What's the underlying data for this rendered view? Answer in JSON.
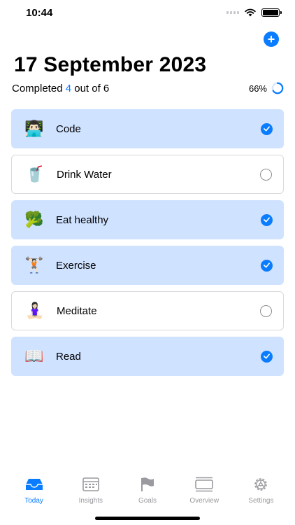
{
  "status_bar": {
    "time": "10:44"
  },
  "header": {
    "title": "17 September 2023",
    "progress_prefix": "Completed",
    "progress_done": "4",
    "progress_suffix": "out of 6",
    "percent": "66%",
    "percent_value": 0.66
  },
  "habits": [
    {
      "emoji": "👨🏻‍💻",
      "label": "Code",
      "done": true
    },
    {
      "emoji": "🥤",
      "label": "Drink Water",
      "done": false
    },
    {
      "emoji": "🥦",
      "label": "Eat healthy",
      "done": true
    },
    {
      "emoji": "🏋🏻",
      "label": "Exercise",
      "done": true
    },
    {
      "emoji": "🧘🏻‍♀️",
      "label": "Meditate",
      "done": false
    },
    {
      "emoji": "📖",
      "label": "Read",
      "done": true
    }
  ],
  "tabs": [
    {
      "label": "Today",
      "icon": "tray-icon",
      "active": true
    },
    {
      "label": "Insights",
      "icon": "calendar-icon",
      "active": false
    },
    {
      "label": "Goals",
      "icon": "flag-icon",
      "active": false
    },
    {
      "label": "Overview",
      "icon": "overview-icon",
      "active": false
    },
    {
      "label": "Settings",
      "icon": "gear-icon",
      "active": false
    }
  ],
  "colors": {
    "accent": "#0a7cff",
    "done_bg": "#cfe2ff",
    "inactive": "#9a9aa0"
  }
}
